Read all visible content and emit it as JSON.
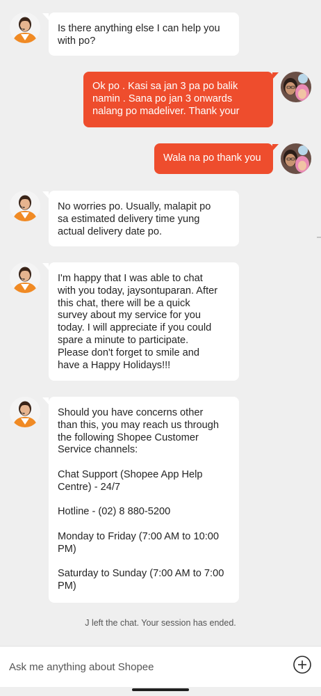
{
  "conversation": {
    "messages": [
      {
        "sender": "agent",
        "text": "Is there anything else I can help you\nwith po?"
      },
      {
        "sender": "user",
        "text": "Ok po  . Kasi sa jan 3 pa po balik\nnamin . Sana po jan 3 onwards\nnalang po madeliver. Thank your"
      },
      {
        "sender": "user",
        "text": "Wala na po thank you"
      },
      {
        "sender": "agent",
        "text": "No worries po. Usually, malapit po\nsa estimated delivery time yung\nactual delivery date po."
      },
      {
        "sender": "agent",
        "text": "I'm happy that I was able to chat\nwith you today, jaysontuparan. After\nthis chat, there will be a quick\nsurvey about my service for you\ntoday. I will appreciate if you could\nspare a minute to participate.\nPlease don't forget to smile and\nhave a Happy Holidays!!!"
      },
      {
        "sender": "agent",
        "text": "Should you have concerns other\nthan this, you may reach us through\nthe following Shopee Customer\nService channels:\n\nChat Support (Shopee App Help\nCentre) - 24/7\n\nHotline - (02) 8 880-5200\n\nMonday to Friday (7:00 AM to 10:00\nPM)\n\nSaturday to Sunday (7:00 AM to 7:00\nPM)"
      }
    ],
    "system_note": "J left the chat. Your session has ended."
  },
  "composer": {
    "placeholder": "Ask me anything about Shopee",
    "attach_icon": "plus-circle-icon"
  },
  "colors": {
    "background": "#efefef",
    "agent_bubble": "#ffffff",
    "user_bubble": "#ee4d2d",
    "user_text": "#ffffff"
  }
}
